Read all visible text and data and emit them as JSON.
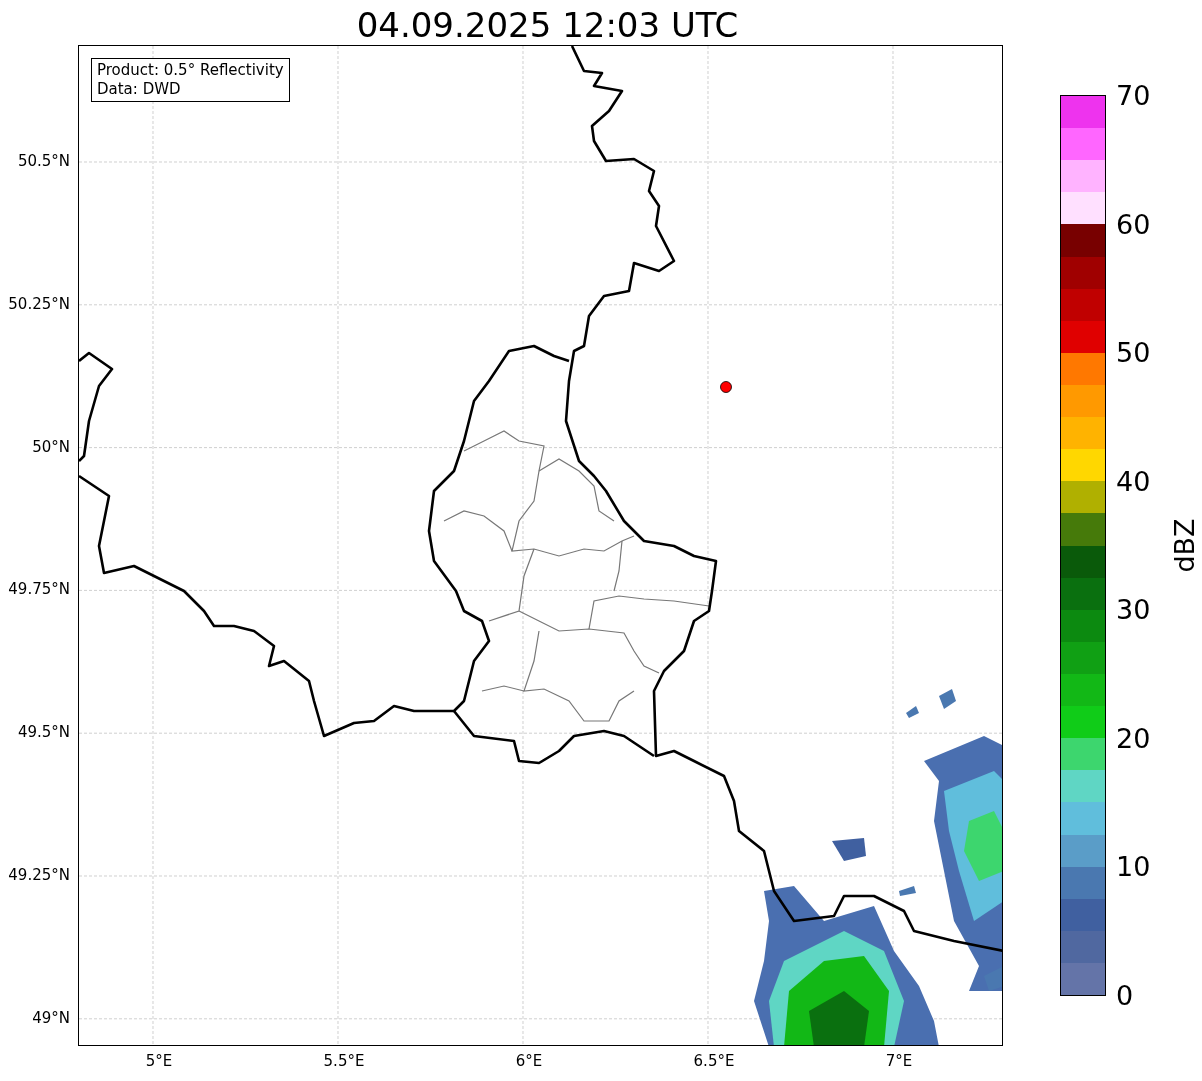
{
  "title": "04.09.2025 12:03 UTC",
  "legend_box": {
    "lines": [
      "Product: 0.5° Reflectivity",
      "Data: DWD"
    ]
  },
  "y_ticks": [
    "50.5°N",
    "50.25°N",
    "50°N",
    "49.75°N",
    "49.5°N",
    "49.25°N",
    "49°N"
  ],
  "x_ticks": [
    "5°E",
    "5.5°E",
    "6°E",
    "6.5°E",
    "7°E"
  ],
  "colorbar": {
    "label": "dBZ",
    "ticks": [
      "70",
      "60",
      "50",
      "40",
      "30",
      "20",
      "10",
      "0"
    ],
    "bins": [
      {
        "color": "#ee33ee"
      },
      {
        "color": "#ff66ff"
      },
      {
        "color": "#ffb3ff"
      },
      {
        "color": "#ffe0ff"
      },
      {
        "color": "#780000"
      },
      {
        "color": "#a00000"
      },
      {
        "color": "#c00000"
      },
      {
        "color": "#e00000"
      },
      {
        "color": "#ff7800"
      },
      {
        "color": "#ff9900"
      },
      {
        "color": "#ffb300"
      },
      {
        "color": "#ffd700"
      },
      {
        "color": "#b0b000"
      },
      {
        "color": "#467a0a"
      },
      {
        "color": "#0a5a0a"
      },
      {
        "color": "#0a700f"
      },
      {
        "color": "#0c8a10"
      },
      {
        "color": "#10a014"
      },
      {
        "color": "#12b816"
      },
      {
        "color": "#10cc18"
      },
      {
        "color": "#3dd66e"
      },
      {
        "color": "#5fd6c4"
      },
      {
        "color": "#60bedc"
      },
      {
        "color": "#5a9dc8"
      },
      {
        "color": "#4a78b0"
      },
      {
        "color": "#4060a0"
      },
      {
        "color": "#5068a0"
      },
      {
        "color": "#6474a8"
      }
    ]
  }
}
